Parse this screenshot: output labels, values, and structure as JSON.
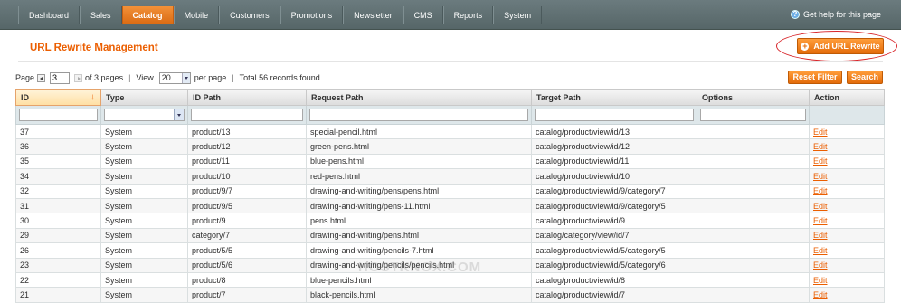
{
  "nav": {
    "items": [
      "Dashboard",
      "Sales",
      "Catalog",
      "Mobile",
      "Customers",
      "Promotions",
      "Newsletter",
      "CMS",
      "Reports",
      "System"
    ],
    "active": "Catalog",
    "help_text": "Get help for this page"
  },
  "page": {
    "title": "URL Rewrite Management",
    "add_button": "Add URL Rewrite"
  },
  "pager": {
    "page_label": "Page",
    "current_page": "3",
    "of_pages": "of 3 pages",
    "view_label": "View",
    "per_page_value": "20",
    "per_page_label": "per page",
    "total": "Total 56 records found"
  },
  "buttons": {
    "reset_filter": "Reset Filter",
    "search": "Search"
  },
  "grid": {
    "columns": [
      "ID",
      "Type",
      "ID Path",
      "Request Path",
      "Target Path",
      "Options",
      "Action"
    ],
    "rows": [
      {
        "id": "37",
        "type": "System",
        "id_path": "product/13",
        "request_path": "special-pencil.html",
        "target_path": "catalog/product/view/id/13",
        "options": "",
        "action": "Edit"
      },
      {
        "id": "36",
        "type": "System",
        "id_path": "product/12",
        "request_path": "green-pens.html",
        "target_path": "catalog/product/view/id/12",
        "options": "",
        "action": "Edit"
      },
      {
        "id": "35",
        "type": "System",
        "id_path": "product/11",
        "request_path": "blue-pens.html",
        "target_path": "catalog/product/view/id/11",
        "options": "",
        "action": "Edit"
      },
      {
        "id": "34",
        "type": "System",
        "id_path": "product/10",
        "request_path": "red-pens.html",
        "target_path": "catalog/product/view/id/10",
        "options": "",
        "action": "Edit"
      },
      {
        "id": "32",
        "type": "System",
        "id_path": "product/9/7",
        "request_path": "drawing-and-writing/pens/pens.html",
        "target_path": "catalog/product/view/id/9/category/7",
        "options": "",
        "action": "Edit"
      },
      {
        "id": "31",
        "type": "System",
        "id_path": "product/9/5",
        "request_path": "drawing-and-writing/pens-11.html",
        "target_path": "catalog/product/view/id/9/category/5",
        "options": "",
        "action": "Edit"
      },
      {
        "id": "30",
        "type": "System",
        "id_path": "product/9",
        "request_path": "pens.html",
        "target_path": "catalog/product/view/id/9",
        "options": "",
        "action": "Edit"
      },
      {
        "id": "29",
        "type": "System",
        "id_path": "category/7",
        "request_path": "drawing-and-writing/pens.html",
        "target_path": "catalog/category/view/id/7",
        "options": "",
        "action": "Edit"
      },
      {
        "id": "26",
        "type": "System",
        "id_path": "product/5/5",
        "request_path": "drawing-and-writing/pencils-7.html",
        "target_path": "catalog/product/view/id/5/category/5",
        "options": "",
        "action": "Edit"
      },
      {
        "id": "23",
        "type": "System",
        "id_path": "product/5/6",
        "request_path": "drawing-and-writing/pencils/pencils.html",
        "target_path": "catalog/product/view/id/5/category/6",
        "options": "",
        "action": "Edit"
      },
      {
        "id": "22",
        "type": "System",
        "id_path": "product/8",
        "request_path": "blue-pencils.html",
        "target_path": "catalog/product/view/id/8",
        "options": "",
        "action": "Edit"
      },
      {
        "id": "21",
        "type": "System",
        "id_path": "product/7",
        "request_path": "black-pencils.html",
        "target_path": "catalog/product/view/id/7",
        "options": "",
        "action": "Edit"
      }
    ]
  },
  "watermark": "HOSTKNOX.COM",
  "colors": {
    "accent": "#eb5e00",
    "nav_bg": "#607072",
    "highlight_ring": "#d8262b"
  }
}
